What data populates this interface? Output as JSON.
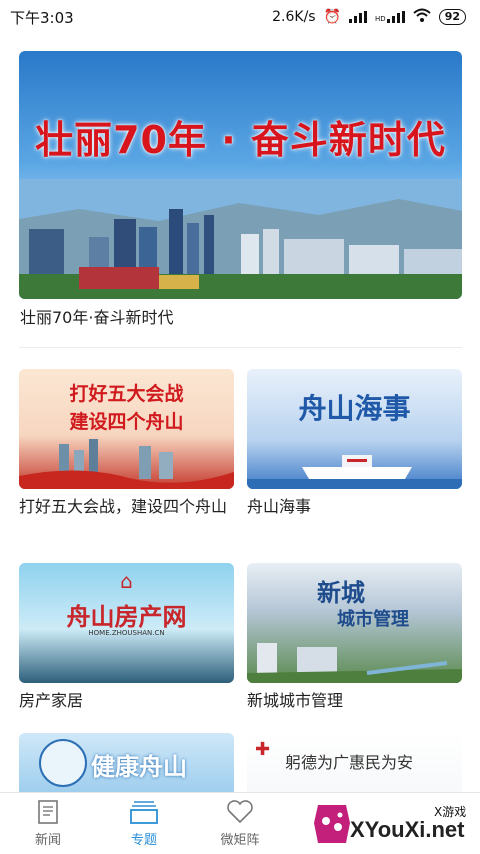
{
  "status": {
    "time": "下午3:03",
    "speed": "2.6K/s",
    "battery": "92",
    "hd_label": "HD"
  },
  "hero": {
    "title": "壮丽70年 · 奋斗新时代",
    "caption": "壮丽70年·奋斗新时代"
  },
  "cards": [
    {
      "caption": "打好五大会战，建设四个舟山",
      "thumb_line1": "打好五大会战",
      "thumb_line2": "建设四个舟山"
    },
    {
      "caption": "舟山海事",
      "thumb_line1": "舟山海事",
      "thumb_line2": ""
    },
    {
      "caption": "房产家居",
      "thumb_line1": "舟山房产网",
      "thumb_line2": "HOME.ZHOUSHAN.CN"
    },
    {
      "caption": "新城城市管理",
      "thumb_line1": "新城",
      "thumb_line2": "城市管理"
    },
    {
      "caption": "",
      "thumb_line1": "健康舟山",
      "thumb_line2": ""
    },
    {
      "caption": "",
      "thumb_line1": "躬德为广惠民为安",
      "thumb_line2": ""
    }
  ],
  "nav": [
    {
      "label": "新闻",
      "icon": "news-icon"
    },
    {
      "label": "专题",
      "icon": "topics-icon"
    },
    {
      "label": "微矩阵",
      "icon": "heart-icon"
    }
  ],
  "watermark": {
    "text": "XYouXi.net",
    "small": "X游戏"
  },
  "colors": {
    "accent": "#2a8fd6",
    "red": "#d8141c"
  }
}
